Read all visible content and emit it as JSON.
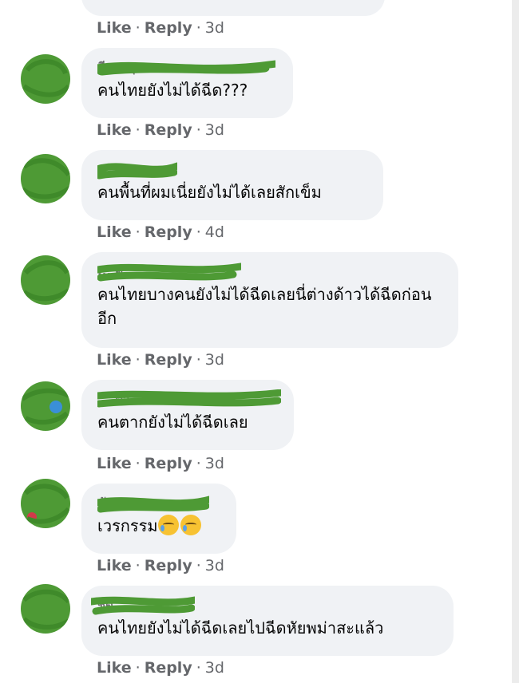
{
  "actions": {
    "like": "Like",
    "reply": "Reply",
    "sep": "·"
  },
  "colors": {
    "scribble": "#4e9a35",
    "bubble": "#f0f2f5",
    "meta": "#65676b"
  },
  "top_meta": {
    "time": "3d"
  },
  "comments": [
    {
      "name": "ดี ... นุสส",
      "text": "คนไทยยังไม่ได้ฉีด???",
      "time": "3d"
    },
    {
      "name": "... นุ",
      "text": "คนพื้นที่ผมเนี่ยยังไม่ได้เลยสักเข็ม",
      "time": "4d"
    },
    {
      "name": "... ดี",
      "text": "คนไทยบางคนยังไม่ได้ฉีดเลยนี่ต่างด้าวได้ฉีดก่อนอีก",
      "time": "3d"
    },
    {
      "name": "... ดา",
      "text": "คนตากยังไม่ได้ฉีดเลย",
      "time": "3d"
    },
    {
      "name": "ชัด ...",
      "text": "เวรกรรม",
      "emoji": "crying-face-icon",
      "time": "3d"
    },
    {
      "name": "ชัด ...",
      "text": "คนไทยยังไม่ได้ฉีดเลยไปฉีดหัยพม่าสะแล้ว",
      "time": "3d"
    }
  ]
}
